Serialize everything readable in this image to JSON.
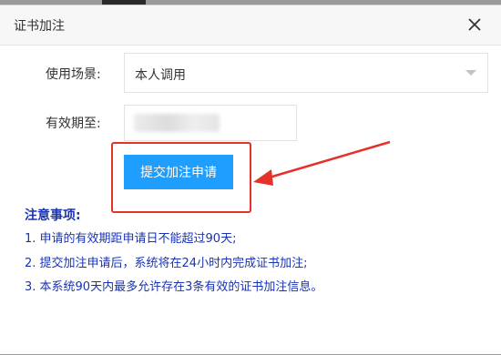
{
  "dialog": {
    "title": "证书加注"
  },
  "form": {
    "scene_label": "使用场景:",
    "scene_value": "本人调用",
    "expire_label": "有效期至:",
    "submit_label": "提交加注申请"
  },
  "notes": {
    "title": "注意事项:",
    "items": [
      "1. 申请的有效期距申请日不能超过90天;",
      "2. 提交加注申请后，系统将在24小时内完成证书加注;",
      "3. 本系统90天内最多允许存在3条有效的证书加注信息。"
    ]
  },
  "colors": {
    "primary_button": "#1e9fff",
    "highlight": "#e6302a",
    "notes_text": "#1a33b3"
  },
  "icons": {
    "close": "close-icon",
    "dropdown": "chevron-down-icon"
  }
}
